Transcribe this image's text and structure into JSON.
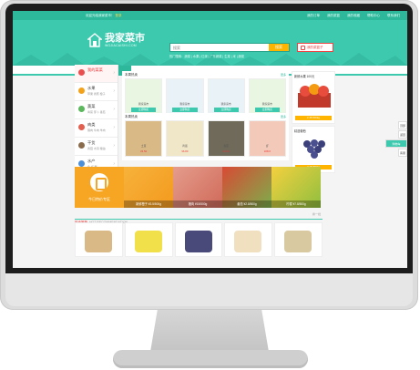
{
  "topbar": {
    "welcome_prefix": "欢迎光临我家菜市！",
    "welcome_login": "登录",
    "links": [
      "我的订单",
      "我的菜篮",
      "我的收藏",
      "帮助中心",
      "联系我们"
    ]
  },
  "header": {
    "logo_name": "我家菜市",
    "logo_site": "WOJIACAISHI.COM",
    "search_placeholder": "搜索",
    "search_button": "搜索",
    "hot_words": "热门搜索：蔬菜 | 水果 | 红烧 | 广东蔬菜 | 生菜 | 米 | 蔬菜",
    "cart_label": "我的菜篮子"
  },
  "nav": {
    "category_tab": "分类"
  },
  "categories": [
    {
      "title": "我的菜菜",
      "sub": "",
      "color": "#e94f4f"
    },
    {
      "title": "水果",
      "sub": "苹果 香蕉 橙子",
      "color": "#f3a31b"
    },
    {
      "title": "蔬菜",
      "sub": "青菜 萝卜 番茄",
      "color": "#5bb85d"
    },
    {
      "title": "肉类",
      "sub": "猪肉 牛肉 羊肉",
      "color": "#e2604f"
    },
    {
      "title": "干货",
      "sub": "香菇 木耳 粮油",
      "color": "#8a6b4c"
    },
    {
      "title": "水产",
      "sub": "鱼 虾 蟹",
      "color": "#4d8fd6"
    }
  ],
  "panels": {
    "top_title": "本周热卖",
    "top_more": "更多",
    "top_items": [
      {
        "label": "我家菜市",
        "price": "立即购买",
        "color": "#e9f6e1"
      },
      {
        "label": "我家菜市",
        "price": "立即购买",
        "color": "#e8f2f7"
      },
      {
        "label": "我家菜市",
        "price": "立即购买",
        "color": "#e8f2f7"
      },
      {
        "label": "我家菜市",
        "price": "立即购买",
        "color": "#e9f6e1"
      }
    ],
    "bottom_title": "本周热卖",
    "bottom_more": "更多",
    "bottom_items": [
      {
        "label": "土豆",
        "price": "¥3.50",
        "color": "#d9b986"
      },
      {
        "label": "鸡蛋",
        "price": "¥6.80",
        "color": "#f0e6c8"
      },
      {
        "label": "香菇",
        "price": "¥12.0",
        "color": "#6f6a5a"
      },
      {
        "label": "虾",
        "price": "¥28.0",
        "color": "#f3c9b9"
      }
    ]
  },
  "promos": {
    "top_title": "新鲜水果 100元",
    "top_price": "¥ 45.50/kg",
    "bottom_title": "精选葡萄",
    "bottom_price": "¥ 15.80/kg"
  },
  "banner": {
    "main_label": "今日特价专区",
    "tiles": [
      {
        "caption": "新鲜橙子 ¥3.5/500g",
        "color1": "#f7b23b",
        "color2": "#f39a1e"
      },
      {
        "caption": "猪肉 ¥15/500g",
        "color1": "#e59c8c",
        "color2": "#d06a5a"
      },
      {
        "caption": "番茄 ¥2.8/500g",
        "color1": "#d84a35",
        "color2": "#7dae4b"
      },
      {
        "caption": "柠檬 ¥7.8/500g",
        "color1": "#f4d03f",
        "color2": "#8fbf3f"
      }
    ]
  },
  "recommend": {
    "title": "热卖推荐",
    "subtitle": "HOT RECOMMENDATION",
    "next": "换一批",
    "items": [
      {
        "color": "#d9b986"
      },
      {
        "color": "#f2e04a"
      },
      {
        "color": "#4a4a7a"
      },
      {
        "color": "#f0e0c0"
      },
      {
        "color": "#d9c9a0"
      }
    ]
  },
  "sidetools": [
    "顶部",
    "返回",
    "购物车",
    "客服"
  ]
}
